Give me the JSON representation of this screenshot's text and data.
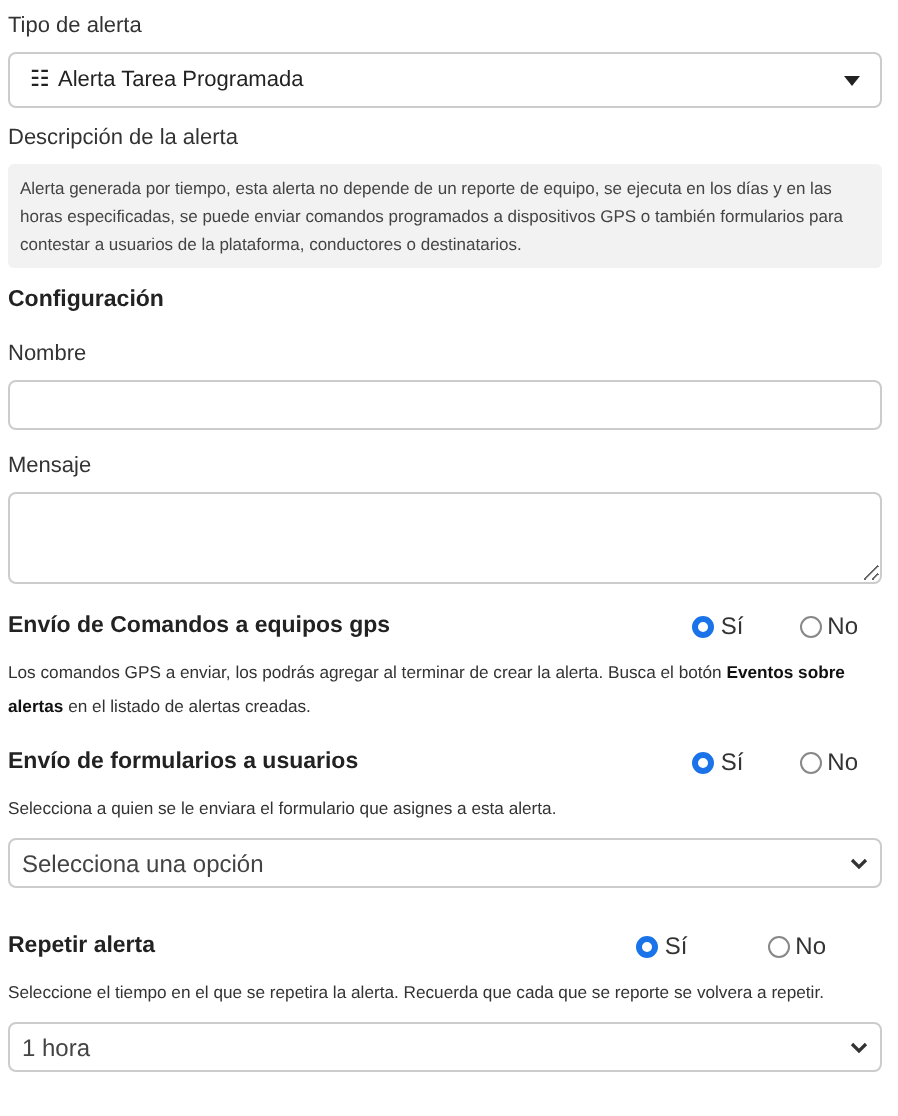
{
  "alert_type": {
    "label": "Tipo de alerta",
    "icon": "☷",
    "value": "Alerta Tarea Programada"
  },
  "description": {
    "label": "Descripción de la alerta",
    "text": "Alerta generada por tiempo, esta alerta no depende de un reporte de equipo, se ejecuta en los días y en las horas especificadas, se puede enviar comandos programados a dispositivos GPS o también formularios para contestar a usuarios de la plataforma, conductores o destinatarios."
  },
  "configuration": {
    "heading": "Configuración",
    "fields": [
      {
        "kind": "input",
        "label": "Nombre"
      },
      {
        "kind": "textarea",
        "label": "Mensaje"
      }
    ]
  },
  "sections": [
    {
      "heading": "Envío de Comandos a equipos gps",
      "options": [
        {
          "label": "Sí",
          "selected": true
        },
        {
          "label": "No",
          "selected": false
        }
      ],
      "note": "Los comandos GPS a enviar, los podrás agregar al terminar de crear la alerta. Busca el botón **Eventos sobre alertas** en el listado de alertas creadas."
    },
    {
      "heading": "Envío de formularios a usuarios",
      "options": [
        {
          "label": "Sí",
          "selected": true
        },
        {
          "label": "No",
          "selected": false
        }
      ],
      "note": "Selecciona a quien se le enviara el formulario que asignes a esta alerta.",
      "select": {
        "value": "Selecciona una opción"
      }
    },
    {
      "heading": "Repetir alerta",
      "options": [
        {
          "label": "Sí",
          "selected": true
        },
        {
          "label": "No",
          "selected": false
        }
      ],
      "note": "Seleccione el tiempo en el que se repetira la alerta. Recuerda que cada que se reporte se volvera a repetir.",
      "select": {
        "value": "1 hora"
      }
    }
  ]
}
